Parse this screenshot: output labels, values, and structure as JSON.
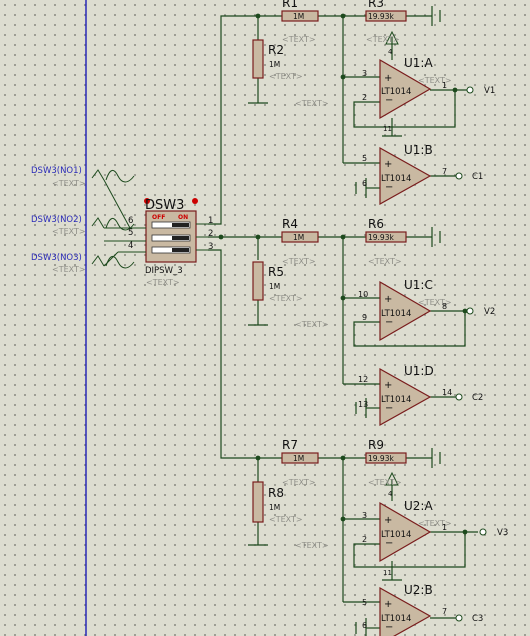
{
  "colors": {
    "background": "#ddddd0",
    "wire": "#1d4a1d",
    "component_outline": "#7a1d1d",
    "component_fill": "#c9b9a2",
    "label": "#111111",
    "hidden_text": "#8f8f88",
    "net_label": "#2a2ab8",
    "bus_line": "#2a2ab8",
    "pin_dot": "#cc0000"
  },
  "placeholder": "<TEXT>",
  "dip_switch": {
    "ref": "DSW3",
    "part": "DIPSW_3",
    "off": "OFF",
    "on": "ON",
    "left_pins": [
      "6",
      "5",
      "4"
    ],
    "right_pins": [
      "1",
      "2",
      "3"
    ]
  },
  "net_labels": [
    "DSW3(NO1)",
    "DSW3(NO2)",
    "DSW3(NO3)"
  ],
  "resistors": [
    {
      "ref": "R1",
      "value": "1M"
    },
    {
      "ref": "R2",
      "value": "1M"
    },
    {
      "ref": "R3",
      "value": "19.93k"
    },
    {
      "ref": "R4",
      "value": "1M"
    },
    {
      "ref": "R5",
      "value": "1M"
    },
    {
      "ref": "R6",
      "value": "19.93k"
    },
    {
      "ref": "R7",
      "value": "1M"
    },
    {
      "ref": "R8",
      "value": "1M"
    },
    {
      "ref": "R9",
      "value": "19.93k"
    }
  ],
  "opamps": [
    {
      "ref": "U1:A",
      "part": "LT1014",
      "plus_pin": "3",
      "minus_pin": "2",
      "out_pin": "1",
      "output": "V1",
      "supply_pins": [
        "4",
        "11"
      ]
    },
    {
      "ref": "U1:B",
      "part": "LT1014",
      "plus_pin": "5",
      "minus_pin": "6",
      "out_pin": "7",
      "output": "C1"
    },
    {
      "ref": "U1:C",
      "part": "LT1014",
      "plus_pin": "10",
      "minus_pin": "9",
      "out_pin": "8",
      "output": "V2"
    },
    {
      "ref": "U1:D",
      "part": "LT1014",
      "plus_pin": "12",
      "minus_pin": "13",
      "out_pin": "14",
      "output": "C2"
    },
    {
      "ref": "U2:A",
      "part": "LT1014",
      "plus_pin": "3",
      "minus_pin": "2",
      "out_pin": "1",
      "output": "V3",
      "supply_pins": [
        "4",
        "11"
      ]
    },
    {
      "ref": "U2:B",
      "part": "LT1014",
      "plus_pin": "5",
      "minus_pin": "6",
      "out_pin": "7",
      "output": "C3"
    }
  ]
}
